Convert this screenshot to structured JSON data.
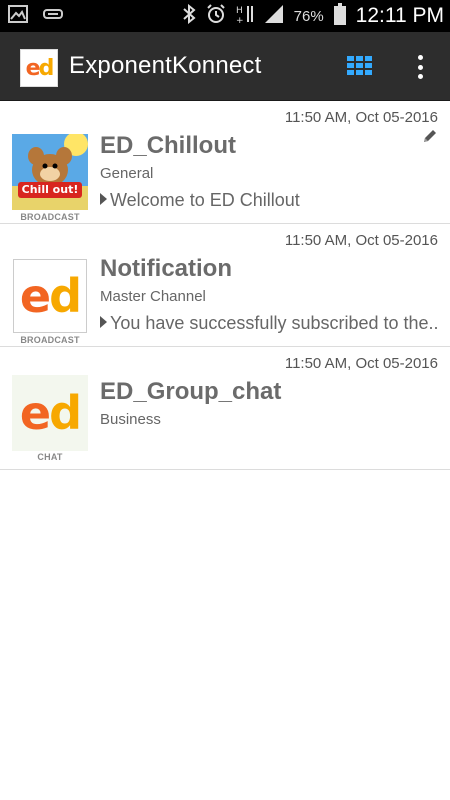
{
  "status_bar": {
    "battery_percent": "76%",
    "time": "12:11 PM",
    "icons": [
      "image-icon",
      "usb-icon",
      "bluetooth-icon",
      "alarm-icon",
      "data-arrows-icon",
      "signal-icon",
      "battery-icon"
    ]
  },
  "app_bar": {
    "title": "ExponentKonnect",
    "logo_text": "ed",
    "icons": [
      "app-logo-icon",
      "grid-icon",
      "overflow-menu-icon"
    ]
  },
  "conversations": [
    {
      "name": "ED_Chillout",
      "channel": "General",
      "preview": "Welcome to ED Chillout",
      "timestamp": "11:50 AM,  Oct 05-2016",
      "type_label": "BROADCAST",
      "thumb_text": "Chill out!",
      "has_edit_icon": true
    },
    {
      "name": "Notification",
      "channel": "Master Channel",
      "preview": "You have successfully subscribed to the..",
      "timestamp": "11:50 AM,  Oct 05-2016",
      "type_label": "BROADCAST",
      "thumb_text": "ed"
    },
    {
      "name": "ED_Group_chat",
      "channel": "Business",
      "preview": "",
      "timestamp": "11:50 AM,  Oct 05-2016",
      "type_label": "CHAT",
      "thumb_text": "ed"
    }
  ],
  "colors": {
    "app_bar": "#2d2d2d",
    "accent_grid": "#33aaff",
    "logo_orange": "#f26522",
    "logo_yellow": "#f7a800"
  }
}
